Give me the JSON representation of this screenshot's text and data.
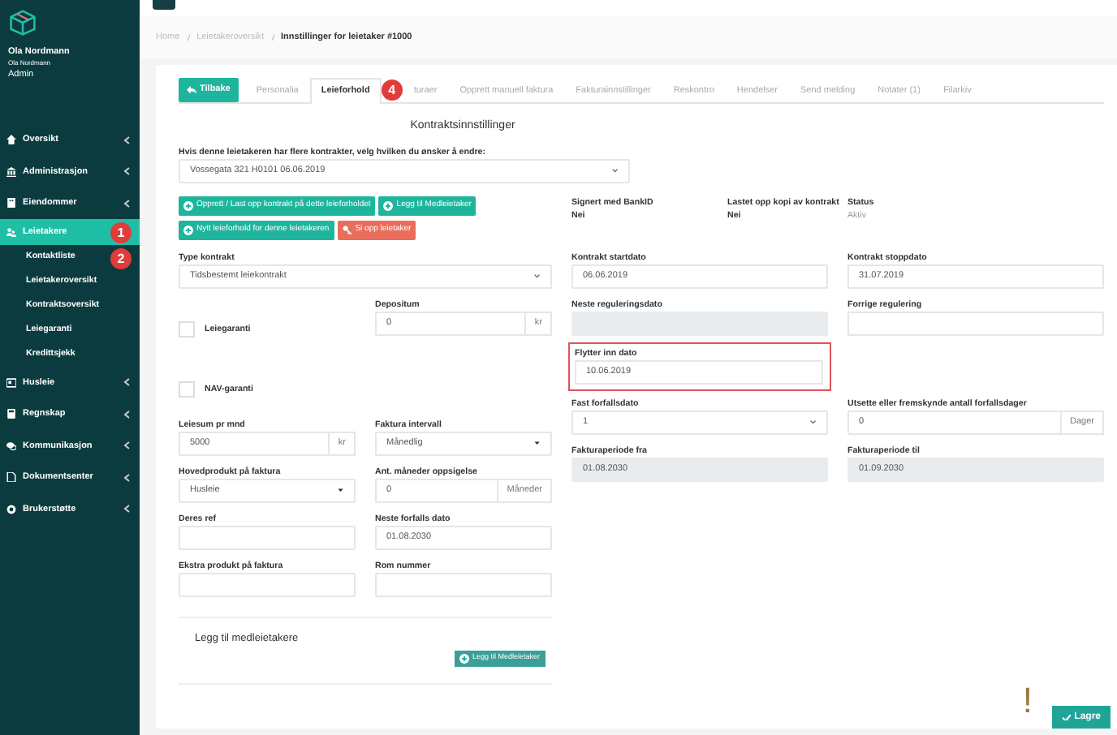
{
  "user": {
    "name": "Ola Nordmann",
    "subtitle": "Ola Nordmann",
    "role": "Admin"
  },
  "sidebar": {
    "items": [
      {
        "label": "Oversikt",
        "selected": false
      },
      {
        "label": "Administrasjon",
        "selected": false
      },
      {
        "label": "Eiendommer",
        "selected": false
      },
      {
        "label": "Leietakere",
        "selected": true,
        "annotation": "1",
        "children": [
          {
            "label": "Kontaktliste",
            "annotation": "2"
          },
          {
            "label": "Leietakeroversikt"
          },
          {
            "label": "Kontraktsoversikt"
          },
          {
            "label": "Leiegaranti"
          },
          {
            "label": "Kredittsjekk"
          }
        ]
      },
      {
        "label": "Husleie",
        "selected": false
      },
      {
        "label": "Regnskap",
        "selected": false
      },
      {
        "label": "Kommunikasjon",
        "selected": false
      },
      {
        "label": "Dokumentsenter",
        "selected": false
      },
      {
        "label": "Brukerstøtte",
        "selected": false
      }
    ]
  },
  "breadcrumb": [
    {
      "label": "Home"
    },
    {
      "label": "Leietakeroversikt"
    },
    {
      "label": "Innstillinger for leietaker #1000"
    }
  ],
  "back_button": "Tilbake",
  "tabs": [
    {
      "label": "Personalia",
      "selected": false
    },
    {
      "label": "Leieforhold",
      "selected": true,
      "annotation": "4"
    },
    {
      "label": "turaer",
      "selected": false
    },
    {
      "label": "Opprett manuell faktura",
      "selected": false
    },
    {
      "label": "Fakturainnstillinger",
      "selected": false
    },
    {
      "label": "Reskontro",
      "selected": false
    },
    {
      "label": "Hendelser",
      "selected": false
    },
    {
      "label": "Send melding",
      "selected": false
    },
    {
      "label": "Notater (1)",
      "selected": false
    },
    {
      "label": "Filarkiv",
      "selected": false
    }
  ],
  "heading": "Kontraktsinnstillinger",
  "contract_select": {
    "label": "Hvis denne leietakeren har flere kontrakter, velg hvilken du ønsker å endre:",
    "value": "Vossegata 321 H0101 06.06.2019"
  },
  "actions": [
    {
      "label": "Opprett / Last opp kontrakt på dette leieforholdet",
      "kind": "primary"
    },
    {
      "label": "Legg til Medleietaker",
      "kind": "primary"
    },
    {
      "label": "Nytt leieforhold for denne leietakeren",
      "kind": "primary"
    },
    {
      "label": "Si opp leietaker",
      "kind": "danger"
    }
  ],
  "info": [
    {
      "label": "Signert med BankID",
      "value": "Nei",
      "muted": false
    },
    {
      "label": "Lastet opp kopi av kontrakt",
      "value": "Nei",
      "muted": false
    },
    {
      "label": "Status",
      "value": "Aktiv",
      "muted": true
    }
  ],
  "left_rows": [
    [
      {
        "kind": "select",
        "label": "Type kontrakt",
        "value": "Tidsbestemt leiekontrakt"
      }
    ],
    [
      {
        "kind": "checkbox",
        "label": "Leiegaranti",
        "checked": false
      },
      {
        "kind": "text",
        "label": "Depositum",
        "value": "0",
        "addon": "kr"
      }
    ],
    [
      {
        "kind": "checkbox",
        "label": "NAV-garanti",
        "checked": false
      }
    ],
    [
      {
        "kind": "text",
        "label": "Leiesum pr mnd",
        "value": "5000",
        "addon": "kr"
      },
      {
        "kind": "select",
        "label": "Faktura intervall",
        "value": "Månedlig"
      }
    ],
    [
      {
        "kind": "select",
        "label": "Hovedprodukt på faktura",
        "value": "Husleie"
      },
      {
        "kind": "text",
        "label": "Ant. måneder oppsigelse",
        "value": "0",
        "addon": "Måneder"
      }
    ],
    [
      {
        "kind": "text",
        "label": "Deres ref"
      },
      {
        "kind": "text",
        "label": "Neste forfalls dato",
        "value": "01.08.2030"
      }
    ],
    [
      {
        "kind": "text",
        "label": "Ekstra produkt på faktura"
      },
      {
        "kind": "text",
        "label": "Rom nummer"
      }
    ]
  ],
  "right_rows": [
    [
      {
        "kind": "text",
        "label": "Kontrakt startdato",
        "value": "06.06.2019"
      },
      {
        "kind": "text",
        "label": "Kontrakt stoppdato",
        "value": "31.07.2019"
      }
    ],
    [
      {
        "kind": "text",
        "label": "Neste reguleringsdato",
        "readonly": true
      },
      {
        "kind": "text",
        "label": "Forrige regulering"
      }
    ],
    [
      {
        "kind": "text",
        "label": "Flytter inn dato",
        "value": "10.06.2019",
        "highlighted": true
      }
    ],
    [
      {
        "kind": "select",
        "label": "Fast forfallsdato",
        "value": "1"
      },
      {
        "kind": "text",
        "label": "Utsette eller fremskynde antall forfallsdager",
        "value": "0",
        "addon": "Dager"
      }
    ],
    [
      {
        "kind": "text",
        "label": "Fakturaperiode fra",
        "value": "01.08.2030",
        "readonly": true
      },
      {
        "kind": "text",
        "label": "Fakturaperiode til",
        "value": "01.09.2030",
        "readonly": true
      }
    ]
  ],
  "co_tenants": {
    "heading": "Legg til medleietakere",
    "button": "Legg til Medleietaker"
  },
  "save_button": {
    "label": "Lagre",
    "annotation": "!"
  }
}
